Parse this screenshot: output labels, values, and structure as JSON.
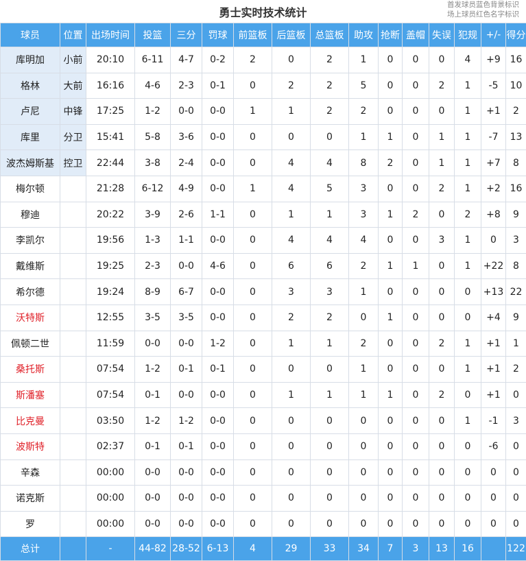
{
  "title": "勇士实时技术统计",
  "legend": [
    "首发球员蓝色背景标识",
    "场上球员红色名字标识"
  ],
  "colors": {
    "header_bg": "#4aa3e9",
    "starter_bg": "#e1ecf8",
    "oncourt_text": "#e0222a"
  },
  "columns": [
    "球员",
    "位置",
    "出场时间",
    "投篮",
    "三分",
    "罚球",
    "前篮板",
    "后篮板",
    "总篮板",
    "助攻",
    "抢断",
    "盖帽",
    "失误",
    "犯规",
    "+/-",
    "得分"
  ],
  "rows": [
    {
      "name": "库明加",
      "pos": "小前",
      "min": "20:10",
      "fg": "6-11",
      "tp": "4-7",
      "ft": "0-2",
      "oreb": "2",
      "dreb": "0",
      "reb": "2",
      "ast": "1",
      "stl": "0",
      "blk": "0",
      "tov": "0",
      "pf": "4",
      "pm": "+9",
      "pts": "16",
      "starter": true,
      "oncourt": false
    },
    {
      "name": "格林",
      "pos": "大前",
      "min": "16:16",
      "fg": "4-6",
      "tp": "2-3",
      "ft": "0-1",
      "oreb": "0",
      "dreb": "2",
      "reb": "2",
      "ast": "5",
      "stl": "0",
      "blk": "0",
      "tov": "2",
      "pf": "1",
      "pm": "-5",
      "pts": "10",
      "starter": true,
      "oncourt": false
    },
    {
      "name": "卢尼",
      "pos": "中锋",
      "min": "17:25",
      "fg": "1-2",
      "tp": "0-0",
      "ft": "0-0",
      "oreb": "1",
      "dreb": "1",
      "reb": "2",
      "ast": "2",
      "stl": "0",
      "blk": "0",
      "tov": "0",
      "pf": "1",
      "pm": "+1",
      "pts": "2",
      "starter": true,
      "oncourt": false
    },
    {
      "name": "库里",
      "pos": "分卫",
      "min": "15:41",
      "fg": "5-8",
      "tp": "3-6",
      "ft": "0-0",
      "oreb": "0",
      "dreb": "0",
      "reb": "0",
      "ast": "1",
      "stl": "1",
      "blk": "0",
      "tov": "1",
      "pf": "1",
      "pm": "-7",
      "pts": "13",
      "starter": true,
      "oncourt": false
    },
    {
      "name": "波杰姆斯基",
      "pos": "控卫",
      "min": "22:44",
      "fg": "3-8",
      "tp": "2-4",
      "ft": "0-0",
      "oreb": "0",
      "dreb": "4",
      "reb": "4",
      "ast": "8",
      "stl": "2",
      "blk": "0",
      "tov": "1",
      "pf": "1",
      "pm": "+7",
      "pts": "8",
      "starter": true,
      "oncourt": false
    },
    {
      "name": "梅尔顿",
      "pos": "",
      "min": "21:28",
      "fg": "6-12",
      "tp": "4-9",
      "ft": "0-0",
      "oreb": "1",
      "dreb": "4",
      "reb": "5",
      "ast": "3",
      "stl": "0",
      "blk": "0",
      "tov": "2",
      "pf": "1",
      "pm": "+2",
      "pts": "16",
      "starter": false,
      "oncourt": false
    },
    {
      "name": "穆迪",
      "pos": "",
      "min": "20:22",
      "fg": "3-9",
      "tp": "2-6",
      "ft": "1-1",
      "oreb": "0",
      "dreb": "1",
      "reb": "1",
      "ast": "3",
      "stl": "1",
      "blk": "2",
      "tov": "0",
      "pf": "2",
      "pm": "+8",
      "pts": "9",
      "starter": false,
      "oncourt": false
    },
    {
      "name": "李凯尔",
      "pos": "",
      "min": "19:56",
      "fg": "1-3",
      "tp": "1-1",
      "ft": "0-0",
      "oreb": "0",
      "dreb": "4",
      "reb": "4",
      "ast": "4",
      "stl": "0",
      "blk": "0",
      "tov": "3",
      "pf": "1",
      "pm": "0",
      "pts": "3",
      "starter": false,
      "oncourt": false
    },
    {
      "name": "戴维斯",
      "pos": "",
      "min": "19:25",
      "fg": "2-3",
      "tp": "0-0",
      "ft": "4-6",
      "oreb": "0",
      "dreb": "6",
      "reb": "6",
      "ast": "2",
      "stl": "1",
      "blk": "1",
      "tov": "0",
      "pf": "1",
      "pm": "+22",
      "pts": "8",
      "starter": false,
      "oncourt": false
    },
    {
      "name": "希尔德",
      "pos": "",
      "min": "19:24",
      "fg": "8-9",
      "tp": "6-7",
      "ft": "0-0",
      "oreb": "0",
      "dreb": "3",
      "reb": "3",
      "ast": "1",
      "stl": "0",
      "blk": "0",
      "tov": "0",
      "pf": "0",
      "pm": "+13",
      "pts": "22",
      "starter": false,
      "oncourt": false
    },
    {
      "name": "沃特斯",
      "pos": "",
      "min": "12:55",
      "fg": "3-5",
      "tp": "3-5",
      "ft": "0-0",
      "oreb": "0",
      "dreb": "2",
      "reb": "2",
      "ast": "0",
      "stl": "1",
      "blk": "0",
      "tov": "0",
      "pf": "0",
      "pm": "+4",
      "pts": "9",
      "starter": false,
      "oncourt": true
    },
    {
      "name": "佩顿二世",
      "pos": "",
      "min": "11:59",
      "fg": "0-0",
      "tp": "0-0",
      "ft": "1-2",
      "oreb": "0",
      "dreb": "1",
      "reb": "1",
      "ast": "2",
      "stl": "0",
      "blk": "0",
      "tov": "2",
      "pf": "1",
      "pm": "+1",
      "pts": "1",
      "starter": false,
      "oncourt": false
    },
    {
      "name": "桑托斯",
      "pos": "",
      "min": "07:54",
      "fg": "1-2",
      "tp": "0-1",
      "ft": "0-1",
      "oreb": "0",
      "dreb": "0",
      "reb": "0",
      "ast": "1",
      "stl": "0",
      "blk": "0",
      "tov": "0",
      "pf": "1",
      "pm": "+1",
      "pts": "2",
      "starter": false,
      "oncourt": true
    },
    {
      "name": "斯潘塞",
      "pos": "",
      "min": "07:54",
      "fg": "0-1",
      "tp": "0-0",
      "ft": "0-0",
      "oreb": "0",
      "dreb": "1",
      "reb": "1",
      "ast": "1",
      "stl": "1",
      "blk": "0",
      "tov": "2",
      "pf": "0",
      "pm": "+1",
      "pts": "0",
      "starter": false,
      "oncourt": true
    },
    {
      "name": "比克曼",
      "pos": "",
      "min": "03:50",
      "fg": "1-2",
      "tp": "1-2",
      "ft": "0-0",
      "oreb": "0",
      "dreb": "0",
      "reb": "0",
      "ast": "0",
      "stl": "0",
      "blk": "0",
      "tov": "0",
      "pf": "1",
      "pm": "-1",
      "pts": "3",
      "starter": false,
      "oncourt": true
    },
    {
      "name": "波斯特",
      "pos": "",
      "min": "02:37",
      "fg": "0-1",
      "tp": "0-1",
      "ft": "0-0",
      "oreb": "0",
      "dreb": "0",
      "reb": "0",
      "ast": "0",
      "stl": "0",
      "blk": "0",
      "tov": "0",
      "pf": "0",
      "pm": "-6",
      "pts": "0",
      "starter": false,
      "oncourt": true
    },
    {
      "name": "辛森",
      "pos": "",
      "min": "00:00",
      "fg": "0-0",
      "tp": "0-0",
      "ft": "0-0",
      "oreb": "0",
      "dreb": "0",
      "reb": "0",
      "ast": "0",
      "stl": "0",
      "blk": "0",
      "tov": "0",
      "pf": "0",
      "pm": "0",
      "pts": "0",
      "starter": false,
      "oncourt": false
    },
    {
      "name": "诺克斯",
      "pos": "",
      "min": "00:00",
      "fg": "0-0",
      "tp": "0-0",
      "ft": "0-0",
      "oreb": "0",
      "dreb": "0",
      "reb": "0",
      "ast": "0",
      "stl": "0",
      "blk": "0",
      "tov": "0",
      "pf": "0",
      "pm": "0",
      "pts": "0",
      "starter": false,
      "oncourt": false
    },
    {
      "name": "罗",
      "pos": "",
      "min": "00:00",
      "fg": "0-0",
      "tp": "0-0",
      "ft": "0-0",
      "oreb": "0",
      "dreb": "0",
      "reb": "0",
      "ast": "0",
      "stl": "0",
      "blk": "0",
      "tov": "0",
      "pf": "0",
      "pm": "0",
      "pts": "0",
      "starter": false,
      "oncourt": false
    }
  ],
  "totals": {
    "name": "总计",
    "pos": "",
    "min": "-",
    "fg": "44-82",
    "tp": "28-52",
    "ft": "6-13",
    "oreb": "4",
    "dreb": "29",
    "reb": "33",
    "ast": "34",
    "stl": "7",
    "blk": "3",
    "tov": "13",
    "pf": "16",
    "pm": "",
    "pts": "122"
  }
}
